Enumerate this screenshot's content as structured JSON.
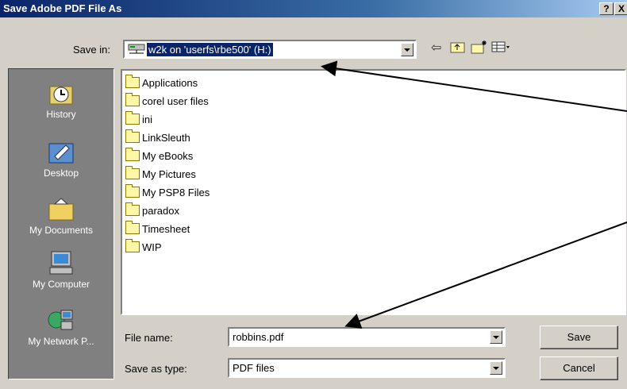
{
  "window": {
    "title": "Save Adobe PDF File As",
    "help_label": "?",
    "close_label": "X"
  },
  "save_in": {
    "label": "Save in:",
    "value": "w2k on 'userfs\\rbe500' (H:)"
  },
  "places": [
    {
      "label": "History",
      "icon": "history-icon"
    },
    {
      "label": "Desktop",
      "icon": "desktop-icon"
    },
    {
      "label": "My Documents",
      "icon": "my-documents-icon"
    },
    {
      "label": "My Computer",
      "icon": "my-computer-icon"
    },
    {
      "label": "My Network P...",
      "icon": "my-network-places-icon"
    }
  ],
  "folders": [
    "Applications",
    "corel user files",
    "ini",
    "LinkSleuth",
    "My eBooks",
    "My Pictures",
    "My PSP8 Files",
    "paradox",
    "Timesheet",
    "WIP"
  ],
  "file_name": {
    "label": "File name:",
    "value": "robbins.pdf"
  },
  "save_as_type": {
    "label": "Save as type:",
    "value": "PDF files"
  },
  "buttons": {
    "save": "Save",
    "cancel": "Cancel"
  },
  "toolbar": {
    "back": "back-arrow-icon",
    "up": "up-folder-icon",
    "new_folder": "new-folder-icon",
    "views": "views-menu-icon"
  },
  "colors": {
    "titlebar": "#0a246a",
    "selection": "#0a246a",
    "dialog": "#d4d0c8"
  }
}
